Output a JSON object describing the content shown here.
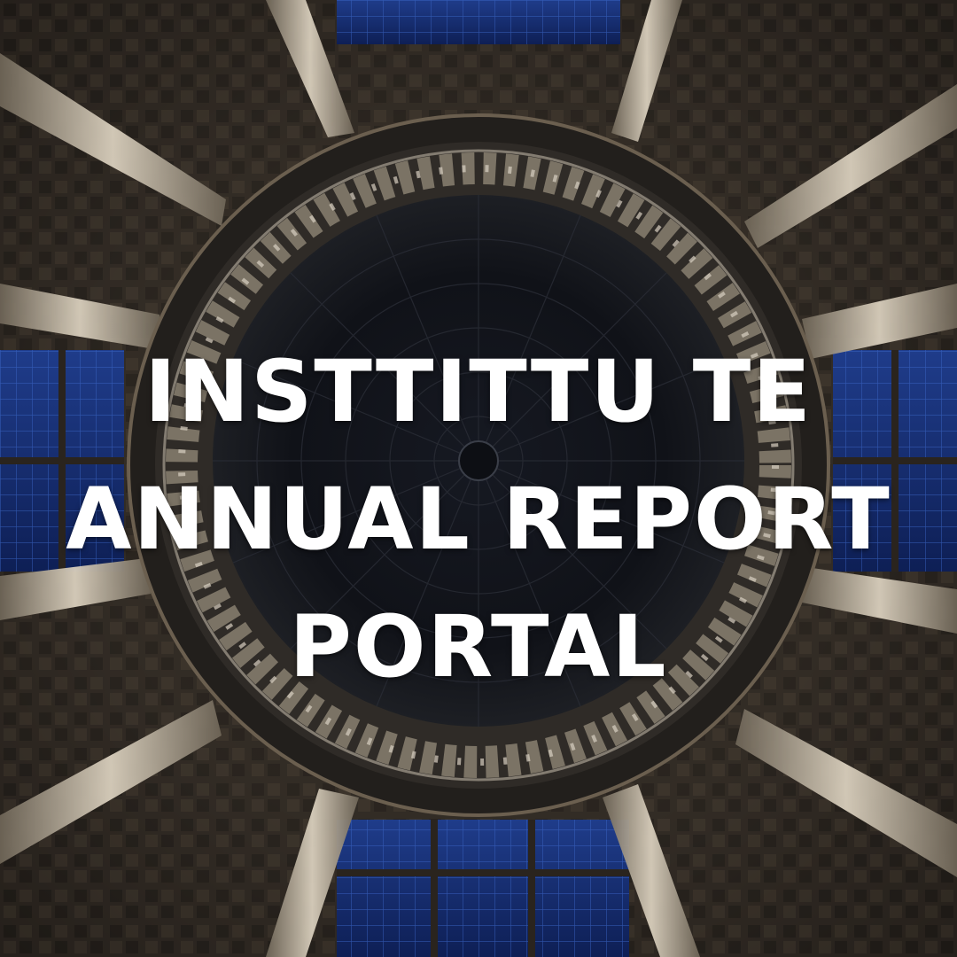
{
  "title": {
    "line1": "INSTTITTU TE",
    "line2": "ANNUAL REPORT",
    "line3": "PORTAL"
  }
}
